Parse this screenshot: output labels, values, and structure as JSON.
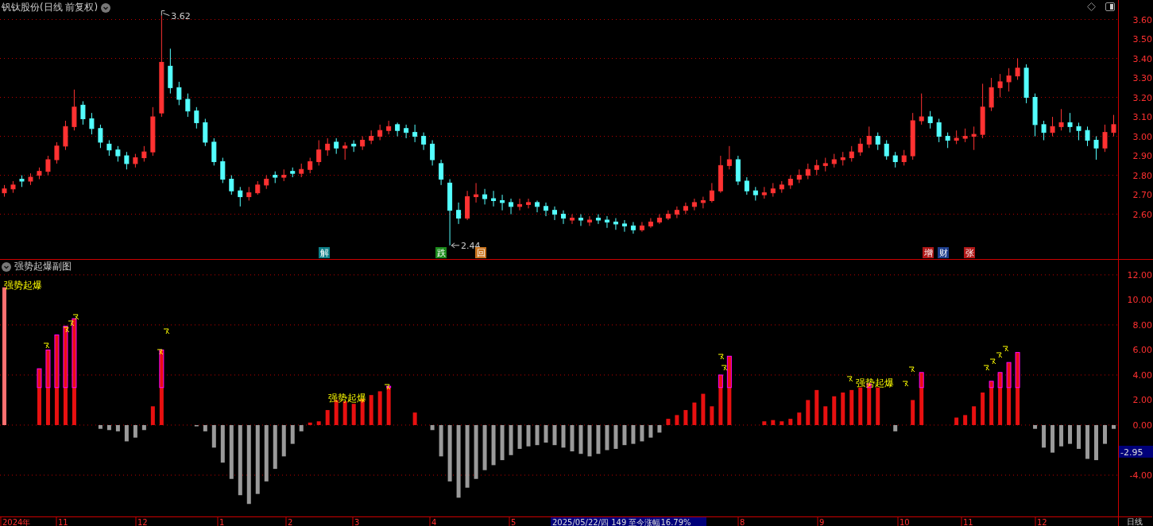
{
  "header": {
    "title": "钒钛股份(日线 前复权)"
  },
  "price_chart": {
    "chart_data": {
      "type": "candlestick",
      "grid": true,
      "categories": [
        null,
        null,
        null,
        null,
        null,
        null,
        null,
        null,
        null,
        null,
        null,
        null,
        null,
        null,
        null,
        null,
        null,
        null,
        null,
        null,
        null,
        null,
        null,
        null,
        null,
        null,
        null,
        null,
        null,
        null,
        null,
        null,
        null,
        null,
        null,
        null,
        null,
        null,
        null,
        null,
        null,
        null,
        null,
        null,
        null,
        null,
        null,
        null,
        null,
        null,
        null,
        null,
        null,
        null,
        null,
        null,
        null,
        null,
        null,
        null,
        null,
        null,
        null,
        null,
        null,
        null,
        null,
        null,
        null,
        null,
        null,
        null,
        null,
        null,
        null,
        null,
        null,
        null,
        null,
        null,
        null,
        null,
        null,
        null,
        null,
        null,
        null,
        null,
        null,
        null,
        null,
        null,
        null,
        null,
        null,
        null,
        null,
        null,
        null,
        null,
        null,
        null,
        null,
        null,
        null,
        null,
        null,
        null,
        null,
        null,
        null,
        null,
        null,
        null,
        null,
        null,
        null,
        null,
        null,
        null,
        null,
        null,
        null,
        null,
        null,
        null,
        null,
        null
      ],
      "ylim": [
        2.37,
        3.7
      ],
      "yticks": [
        {
          "value": 3.6,
          "label": "3.60"
        },
        {
          "value": 3.5,
          "label": "3.50"
        },
        {
          "value": 3.4,
          "label": "3.40"
        },
        {
          "value": 3.3,
          "label": "3.30"
        },
        {
          "value": 3.2,
          "label": "3.20"
        },
        {
          "value": 3.1,
          "label": "3.10"
        },
        {
          "value": 3.0,
          "label": "3.00"
        },
        {
          "value": 2.9,
          "label": "2.90"
        },
        {
          "value": 2.8,
          "label": "2.80"
        },
        {
          "value": 2.7,
          "label": "2.70"
        },
        {
          "value": 2.6,
          "label": "2.60"
        }
      ],
      "ohlc": [
        [
          2.71,
          2.75,
          2.69,
          2.73
        ],
        [
          2.73,
          2.77,
          2.71,
          2.75
        ],
        [
          2.78,
          2.8,
          2.74,
          2.77
        ],
        [
          2.77,
          2.81,
          2.75,
          2.79
        ],
        [
          2.8,
          2.84,
          2.78,
          2.82
        ],
        [
          2.82,
          2.9,
          2.8,
          2.88
        ],
        [
          2.88,
          2.97,
          2.86,
          2.95
        ],
        [
          2.95,
          3.08,
          2.93,
          3.05
        ],
        [
          3.05,
          3.24,
          3.03,
          3.15
        ],
        [
          3.16,
          3.18,
          3.06,
          3.09
        ],
        [
          3.09,
          3.12,
          3.01,
          3.04
        ],
        [
          3.04,
          3.06,
          2.94,
          2.97
        ],
        [
          2.96,
          2.98,
          2.9,
          2.93
        ],
        [
          2.93,
          2.95,
          2.87,
          2.9
        ],
        [
          2.9,
          2.92,
          2.83,
          2.86
        ],
        [
          2.86,
          2.91,
          2.84,
          2.89
        ],
        [
          2.89,
          2.95,
          2.87,
          2.92
        ],
        [
          2.92,
          3.15,
          2.9,
          3.1
        ],
        [
          3.12,
          3.62,
          3.1,
          3.38
        ],
        [
          3.36,
          3.45,
          3.22,
          3.25
        ],
        [
          3.25,
          3.28,
          3.16,
          3.19
        ],
        [
          3.19,
          3.22,
          3.1,
          3.13
        ],
        [
          3.13,
          3.15,
          3.04,
          3.07
        ],
        [
          3.07,
          3.09,
          2.95,
          2.97
        ],
        [
          2.97,
          2.99,
          2.85,
          2.87
        ],
        [
          2.87,
          2.89,
          2.76,
          2.78
        ],
        [
          2.78,
          2.8,
          2.7,
          2.72
        ],
        [
          2.72,
          2.74,
          2.64,
          2.69
        ],
        [
          2.69,
          2.74,
          2.67,
          2.71
        ],
        [
          2.71,
          2.77,
          2.7,
          2.75
        ],
        [
          2.75,
          2.8,
          2.73,
          2.78
        ],
        [
          2.8,
          2.82,
          2.76,
          2.79
        ],
        [
          2.79,
          2.83,
          2.77,
          2.8
        ],
        [
          2.82,
          2.84,
          2.79,
          2.81
        ],
        [
          2.81,
          2.86,
          2.79,
          2.83
        ],
        [
          2.83,
          2.89,
          2.81,
          2.87
        ],
        [
          2.87,
          2.98,
          2.85,
          2.93
        ],
        [
          2.93,
          2.99,
          2.9,
          2.96
        ],
        [
          2.97,
          2.99,
          2.91,
          2.94
        ],
        [
          2.94,
          2.97,
          2.88,
          2.95
        ],
        [
          2.96,
          2.98,
          2.92,
          2.95
        ],
        [
          2.95,
          3.0,
          2.93,
          2.98
        ],
        [
          2.98,
          3.03,
          2.96,
          3.0
        ],
        [
          3.0,
          3.06,
          2.98,
          3.03
        ],
        [
          3.03,
          3.08,
          3.01,
          3.05
        ],
        [
          3.06,
          3.07,
          3.0,
          3.03
        ],
        [
          3.04,
          3.06,
          2.99,
          3.02
        ],
        [
          3.02,
          3.06,
          2.97,
          3.0
        ],
        [
          3.0,
          3.02,
          2.93,
          2.96
        ],
        [
          2.96,
          2.98,
          2.85,
          2.88
        ],
        [
          2.86,
          2.88,
          2.75,
          2.78
        ],
        [
          2.76,
          2.78,
          2.44,
          2.62
        ],
        [
          2.62,
          2.66,
          2.55,
          2.58
        ],
        [
          2.58,
          2.72,
          2.57,
          2.69
        ],
        [
          2.69,
          2.76,
          2.66,
          2.7
        ],
        [
          2.7,
          2.73,
          2.65,
          2.68
        ],
        [
          2.68,
          2.72,
          2.64,
          2.67
        ],
        [
          2.67,
          2.7,
          2.62,
          2.66
        ],
        [
          2.66,
          2.68,
          2.6,
          2.64
        ],
        [
          2.64,
          2.68,
          2.62,
          2.65
        ],
        [
          2.65,
          2.68,
          2.63,
          2.66
        ],
        [
          2.66,
          2.67,
          2.61,
          2.64
        ],
        [
          2.64,
          2.66,
          2.59,
          2.62
        ],
        [
          2.62,
          2.64,
          2.57,
          2.6
        ],
        [
          2.6,
          2.62,
          2.55,
          2.58
        ],
        [
          2.57,
          2.6,
          2.55,
          2.58
        ],
        [
          2.58,
          2.6,
          2.54,
          2.57
        ],
        [
          2.56,
          2.59,
          2.54,
          2.57
        ],
        [
          2.58,
          2.6,
          2.55,
          2.57
        ],
        [
          2.57,
          2.59,
          2.53,
          2.56
        ],
        [
          2.56,
          2.58,
          2.52,
          2.55
        ],
        [
          2.55,
          2.57,
          2.51,
          2.54
        ],
        [
          2.54,
          2.56,
          2.5,
          2.52
        ],
        [
          2.52,
          2.56,
          2.51,
          2.54
        ],
        [
          2.54,
          2.58,
          2.53,
          2.56
        ],
        [
          2.56,
          2.6,
          2.55,
          2.58
        ],
        [
          2.58,
          2.62,
          2.57,
          2.6
        ],
        [
          2.6,
          2.64,
          2.58,
          2.62
        ],
        [
          2.62,
          2.66,
          2.6,
          2.64
        ],
        [
          2.64,
          2.68,
          2.62,
          2.66
        ],
        [
          2.66,
          2.69,
          2.63,
          2.67
        ],
        [
          2.67,
          2.76,
          2.66,
          2.72
        ],
        [
          2.72,
          2.9,
          2.71,
          2.85
        ],
        [
          2.85,
          2.95,
          2.83,
          2.88
        ],
        [
          2.88,
          2.9,
          2.75,
          2.77
        ],
        [
          2.77,
          2.79,
          2.7,
          2.72
        ],
        [
          2.72,
          2.74,
          2.67,
          2.7
        ],
        [
          2.7,
          2.74,
          2.68,
          2.71
        ],
        [
          2.71,
          2.76,
          2.69,
          2.73
        ],
        [
          2.73,
          2.77,
          2.71,
          2.75
        ],
        [
          2.75,
          2.8,
          2.73,
          2.78
        ],
        [
          2.78,
          2.83,
          2.76,
          2.8
        ],
        [
          2.8,
          2.86,
          2.78,
          2.83
        ],
        [
          2.83,
          2.88,
          2.8,
          2.85
        ],
        [
          2.85,
          2.89,
          2.82,
          2.86
        ],
        [
          2.86,
          2.91,
          2.84,
          2.88
        ],
        [
          2.88,
          2.92,
          2.85,
          2.89
        ],
        [
          2.89,
          2.95,
          2.87,
          2.92
        ],
        [
          2.92,
          2.99,
          2.9,
          2.96
        ],
        [
          2.96,
          3.05,
          2.94,
          3.0
        ],
        [
          3.0,
          3.02,
          2.93,
          2.96
        ],
        [
          2.96,
          2.98,
          2.88,
          2.9
        ],
        [
          2.9,
          2.92,
          2.84,
          2.87
        ],
        [
          2.87,
          2.93,
          2.85,
          2.9
        ],
        [
          2.9,
          3.12,
          2.88,
          3.08
        ],
        [
          3.08,
          3.22,
          3.06,
          3.1
        ],
        [
          3.1,
          3.13,
          3.04,
          3.07
        ],
        [
          3.07,
          3.09,
          2.97,
          3.0
        ],
        [
          3.0,
          3.02,
          2.94,
          2.98
        ],
        [
          2.98,
          3.03,
          2.96,
          2.99
        ],
        [
          2.99,
          3.04,
          2.97,
          3.0
        ],
        [
          3.0,
          3.05,
          2.93,
          3.01
        ],
        [
          3.01,
          3.27,
          2.99,
          3.15
        ],
        [
          3.15,
          3.3,
          3.13,
          3.25
        ],
        [
          3.25,
          3.32,
          3.2,
          3.28
        ],
        [
          3.28,
          3.35,
          3.23,
          3.31
        ],
        [
          3.31,
          3.4,
          3.29,
          3.35
        ],
        [
          3.35,
          3.37,
          3.17,
          3.2
        ],
        [
          3.2,
          3.22,
          3.0,
          3.06
        ],
        [
          3.06,
          3.08,
          2.98,
          3.02
        ],
        [
          3.02,
          3.1,
          3.0,
          3.05
        ],
        [
          3.05,
          3.14,
          3.03,
          3.07
        ],
        [
          3.07,
          3.12,
          3.02,
          3.05
        ],
        [
          3.05,
          3.07,
          2.98,
          3.03
        ],
        [
          3.03,
          3.05,
          2.95,
          2.98
        ],
        [
          2.98,
          3.0,
          2.88,
          2.94
        ],
        [
          2.94,
          3.06,
          2.92,
          3.02
        ],
        [
          3.02,
          3.11,
          3.0,
          3.06
        ]
      ]
    },
    "high_marker": "3.62",
    "low_marker": "2.44",
    "signals": [
      {
        "label": "解",
        "color": "#0e7f88"
      },
      {
        "label": "跌",
        "color": "#1b8a1b"
      },
      {
        "label": "回",
        "color": "#c8731e"
      },
      {
        "label": "增",
        "color": "#b01818"
      },
      {
        "label": "财",
        "color": "#1c3d8c"
      },
      {
        "label": "张",
        "color": "#b01818"
      }
    ]
  },
  "sub_chart": {
    "title": "强势起爆副图",
    "chart_data": {
      "type": "bar",
      "grid": true,
      "categories": [
        null,
        null,
        null,
        null,
        null,
        null,
        null,
        null,
        null,
        null,
        null,
        null,
        null,
        null,
        null,
        null,
        null,
        null,
        null,
        null,
        null,
        null,
        null,
        null,
        null,
        null,
        null,
        null,
        null,
        null,
        null,
        null,
        null,
        null,
        null,
        null,
        null,
        null,
        null,
        null,
        null,
        null,
        null,
        null,
        null,
        null,
        null,
        null,
        null,
        null,
        null,
        null,
        null,
        null,
        null,
        null,
        null,
        null,
        null,
        null,
        null,
        null,
        null,
        null,
        null,
        null,
        null,
        null,
        null,
        null,
        null,
        null,
        null,
        null,
        null,
        null,
        null,
        null,
        null,
        null,
        null,
        null,
        null,
        null,
        null,
        null,
        null,
        null,
        null,
        null,
        null,
        null,
        null,
        null,
        null,
        null,
        null,
        null,
        null,
        null,
        null,
        null,
        null,
        null,
        null,
        null,
        null,
        null,
        null,
        null,
        null,
        null,
        null,
        null,
        null,
        null,
        null,
        null,
        null,
        null,
        null,
        null,
        null,
        null,
        null,
        null,
        null,
        null
      ],
      "ylim": [
        -7.3,
        13.2
      ],
      "yticks": [
        {
          "value": 12,
          "label": "12.00"
        },
        {
          "value": 10,
          "label": "10.00"
        },
        {
          "value": 8,
          "label": "8.00"
        },
        {
          "value": 6,
          "label": "6.00"
        },
        {
          "value": 4,
          "label": "4.00"
        },
        {
          "value": 2,
          "label": "2.00"
        },
        {
          "value": 0,
          "label": "0.00"
        },
        {
          "value": -4,
          "label": "-4.00"
        }
      ],
      "values": [
        11,
        0,
        0,
        0,
        4.5,
        6.0,
        7.2,
        7.9,
        8.5,
        0,
        0,
        -0.3,
        -0.4,
        -0.5,
        -1.3,
        -1.0,
        -0.4,
        1.5,
        6.0,
        0,
        0,
        0,
        -0.1,
        -0.5,
        -1.8,
        -3.0,
        -4.3,
        -5.6,
        -6.3,
        -5.5,
        -4.5,
        -3.5,
        -2.5,
        -1.5,
        -0.5,
        0.2,
        0.3,
        1.2,
        2.0,
        1.9,
        1.7,
        2.1,
        2.4,
        2.7,
        3.1,
        0,
        0,
        1.0,
        0,
        -0.4,
        -2.5,
        -4.5,
        -5.8,
        -5.0,
        -4.3,
        -3.6,
        -3.2,
        -2.8,
        -2.4,
        -1.9,
        -1.7,
        -1.6,
        -1.4,
        -1.6,
        -1.8,
        -2.1,
        -2.3,
        -2.5,
        -2.3,
        -2.0,
        -1.9,
        -1.6,
        -1.5,
        -1.3,
        -1.0,
        -0.6,
        0.5,
        0.8,
        1.2,
        1.8,
        2.5,
        1.5,
        4.0,
        5.5,
        0,
        0,
        0,
        0.3,
        0.4,
        0.3,
        0.5,
        1.0,
        2.0,
        2.8,
        1.5,
        2.3,
        2.6,
        2.8,
        3.0,
        3.3,
        3.0,
        0,
        -0.5,
        0,
        2.0,
        4.2,
        0,
        0,
        0,
        0.6,
        0.8,
        1.5,
        2.6,
        3.5,
        4.2,
        5.0,
        5.8,
        0,
        -0.3,
        -1.8,
        -2.2,
        -1.7,
        -1.5,
        -1.9,
        -2.7,
        -2.8,
        -1.5,
        -0.3
      ]
    },
    "current_value": "-2.95",
    "signal_labels": [
      "强势起爆",
      "强势起爆",
      "强势起爆"
    ]
  },
  "time_axis": {
    "labels": [
      "2024年",
      "11",
      "12",
      "1",
      "2",
      "3",
      "4",
      "5",
      "8",
      "9",
      "10",
      "11",
      "12"
    ],
    "readout": "2025/05/22/四 149 至今涨幅16.79%",
    "period": "日线"
  }
}
